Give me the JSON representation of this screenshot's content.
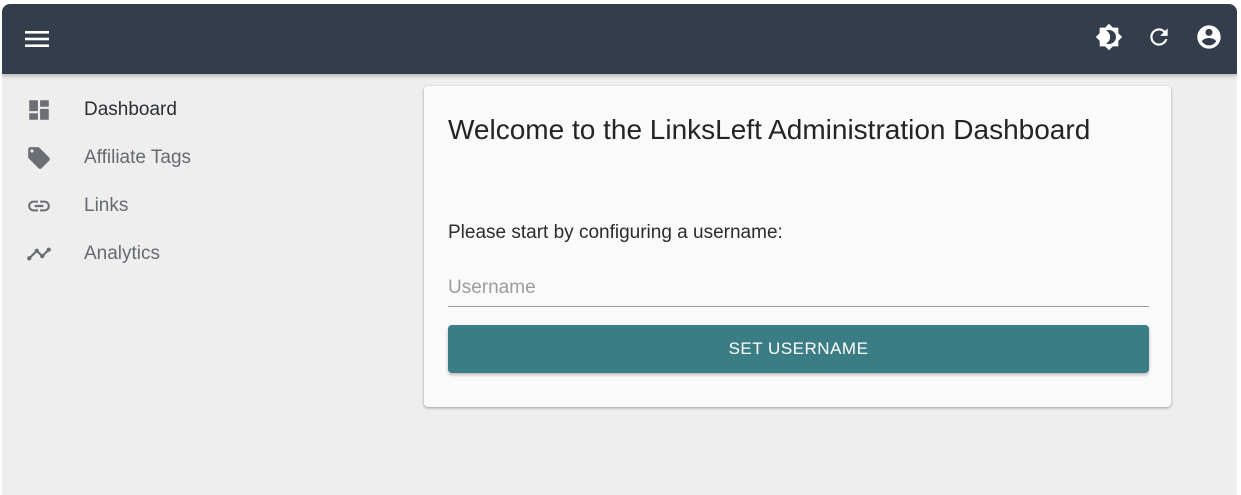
{
  "colors": {
    "appbar": "#333d4b",
    "background": "#eeeeee",
    "card": "#fafafa",
    "button": "#3b7d85",
    "button_text": "#ffffff"
  },
  "appbar": {
    "menu_icon": "menu-icon",
    "actions": [
      {
        "icon": "brightness-icon"
      },
      {
        "icon": "refresh-icon"
      },
      {
        "icon": "account-circle-icon"
      }
    ]
  },
  "sidebar": {
    "items": [
      {
        "label": "Dashboard",
        "icon": "dashboard-icon",
        "active": true
      },
      {
        "label": "Affiliate Tags",
        "icon": "tag-icon",
        "active": false
      },
      {
        "label": "Links",
        "icon": "link-icon",
        "active": false
      },
      {
        "label": "Analytics",
        "icon": "analytics-icon",
        "active": false
      }
    ]
  },
  "main": {
    "title": "Welcome to the LinksLeft Administration Dashboard",
    "prompt": "Please start by configuring a username:",
    "username_field": {
      "placeholder": "Username",
      "value": ""
    },
    "submit_label": "SET USERNAME"
  }
}
